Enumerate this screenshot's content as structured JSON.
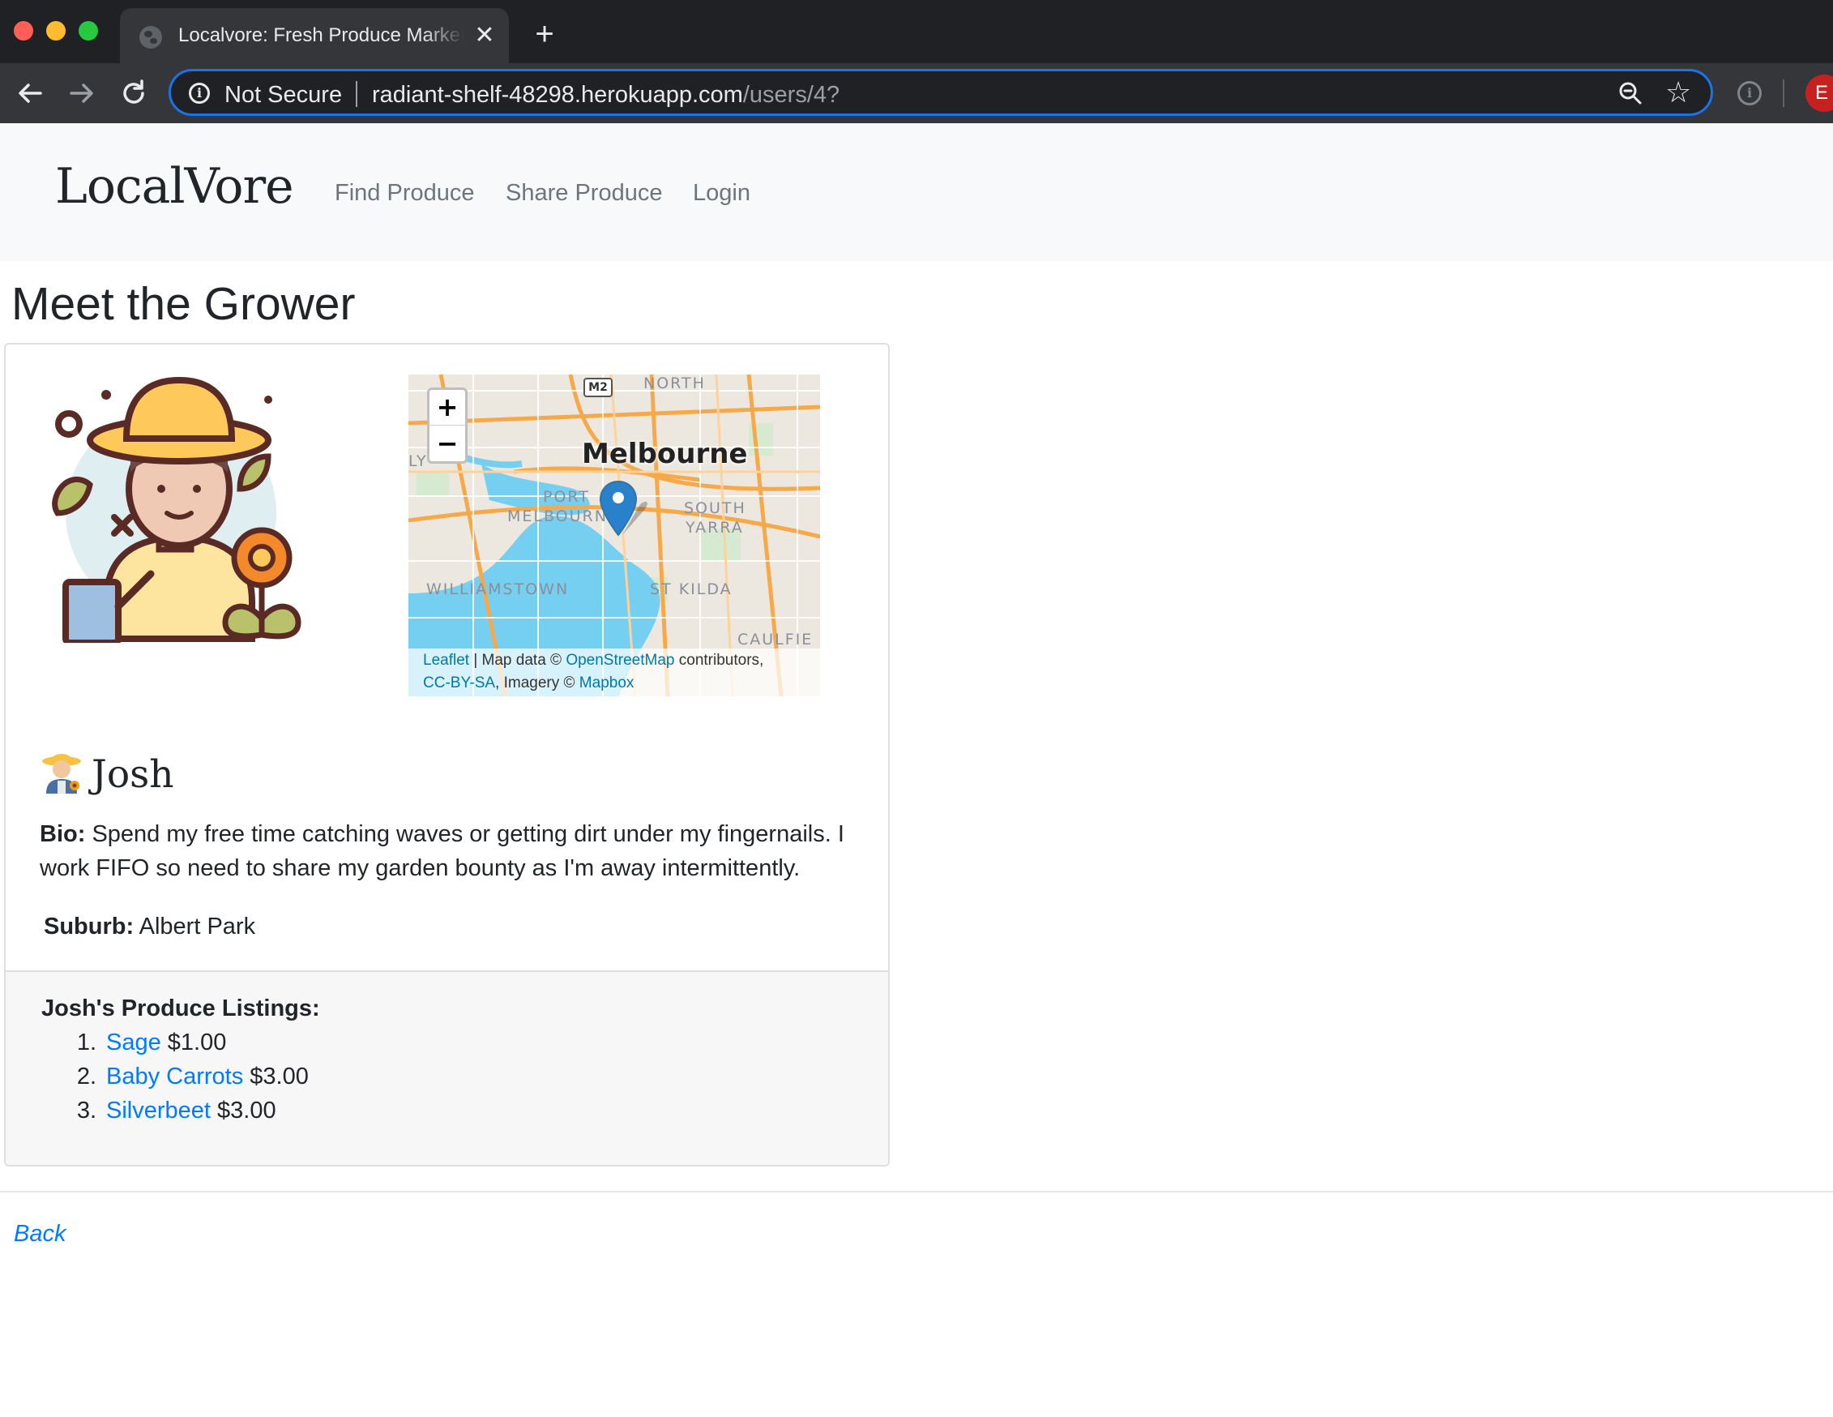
{
  "browser": {
    "tab_title": "Localvore: Fresh Produce Market",
    "tab_close": "✕",
    "new_tab": "+",
    "security_label": "Not Secure",
    "url_host": "radiant-shelf-48298.herokuapp.com",
    "url_path": "/users/4?",
    "profile_initial": "E",
    "icons": [
      "globe-icon",
      "back-arrow-icon",
      "forward-arrow-icon",
      "reload-icon",
      "info-icon",
      "zoom-icon",
      "star-icon",
      "extension-icon"
    ]
  },
  "nav": {
    "brand": "LocalVore",
    "links": [
      "Find Produce",
      "Share Produce",
      "Login"
    ]
  },
  "page": {
    "title": "Meet the Grower"
  },
  "map": {
    "city": "Melbourne",
    "road_badge": "M2",
    "labels": [
      "NORTH",
      "PORT",
      "MELBOURN",
      "SOUTH",
      "YARRA",
      "WILLIAMSTOWN",
      "ST KILDA",
      "CAULFIE",
      "LY"
    ],
    "zoom_in": "+",
    "zoom_out": "−",
    "attribution": {
      "leaflet": "Leaflet",
      "sep": " | Map data © ",
      "osm": "OpenStreetMap",
      "contrib": " contributors,",
      "license": "CC-BY-SA",
      "imagery": ", Imagery © ",
      "mapbox": "Mapbox"
    },
    "colors": {
      "water": "#75cff0",
      "land": "#ece8df",
      "roads": "#f7a94a",
      "marker": "#2a81cb"
    }
  },
  "grower": {
    "name": "Josh",
    "bio_label": "Bio:",
    "bio": "Spend my free time catching waves or getting dirt under my fingernails. I work FIFO so need to share my garden bounty as I'm away intermittently.",
    "suburb_label": "Suburb:",
    "suburb": "Albert Park"
  },
  "listings": {
    "heading": "Josh's Produce Listings:",
    "items": [
      {
        "num": "1.",
        "name": "Sage",
        "price": "$1.00"
      },
      {
        "num": "2.",
        "name": "Baby Carrots",
        "price": "$3.00"
      },
      {
        "num": "3.",
        "name": "Silverbeet",
        "price": "$3.00"
      }
    ]
  },
  "footer": {
    "back": "Back"
  },
  "theme": {
    "link_color": "#007bff",
    "nav_bg": "#f8f9fa",
    "chrome_dark": "#202124"
  }
}
